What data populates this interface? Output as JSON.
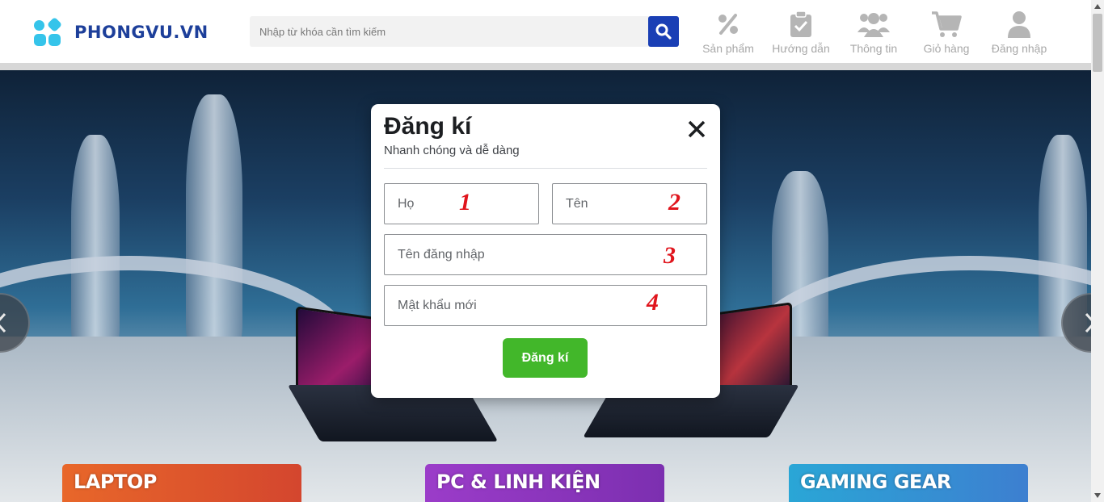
{
  "header": {
    "logo_text": "PHONGVU.VN",
    "search": {
      "placeholder": "Nhập từ khóa cần tìm kiếm"
    },
    "nav": [
      {
        "label": "Sản phẩm",
        "icon": "percent-tag-icon"
      },
      {
        "label": "Hướng dẫn",
        "icon": "clipboard-check-icon"
      },
      {
        "label": "Thông tin",
        "icon": "users-icon"
      },
      {
        "label": "Giỏ hàng",
        "icon": "cart-icon"
      },
      {
        "label": "Đăng nhập",
        "icon": "user-icon"
      }
    ]
  },
  "banner": {
    "categories": [
      {
        "label": "LAPTOP",
        "color": "#e8672a"
      },
      {
        "label": "PC & LINH KIỆN",
        "color": "#9b3cc9"
      },
      {
        "label": "GAMING GEAR",
        "color": "#2aa6d6"
      }
    ]
  },
  "modal": {
    "title": "Đăng kí",
    "subtitle": "Nhanh chóng và dễ dàng",
    "fields": {
      "last_name": {
        "placeholder": "Họ",
        "value": "",
        "marker": "1"
      },
      "first_name": {
        "placeholder": "Tên",
        "value": "",
        "marker": "2"
      },
      "username": {
        "placeholder": "Tên đăng nhập",
        "value": "",
        "marker": "3"
      },
      "password": {
        "placeholder": "Mật khẩu mới",
        "value": "",
        "marker": "4"
      }
    },
    "submit_label": "Đăng kí"
  },
  "colors": {
    "brand_blue": "#1d3f9a",
    "logo_cyan": "#35c4ea",
    "search_button": "#1a3fb5",
    "submit_green": "#42b72a",
    "annotation_red": "#e0151d"
  }
}
